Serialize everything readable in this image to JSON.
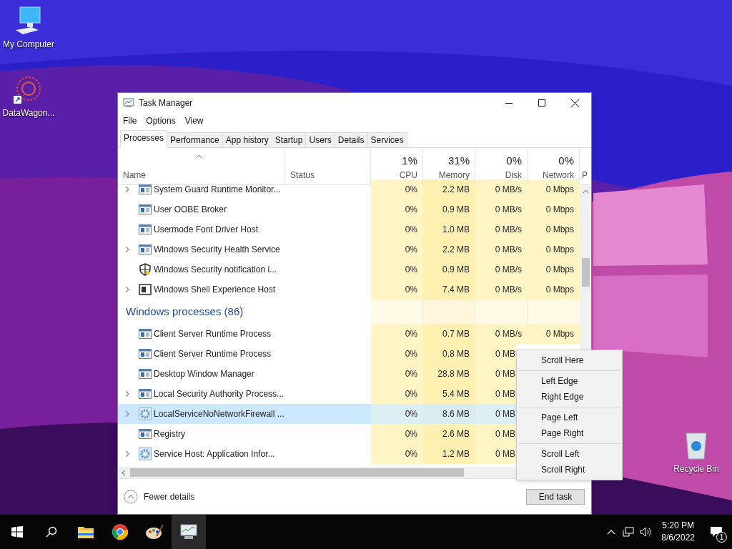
{
  "desktop_icons": [
    {
      "label": "My Computer",
      "kind": "computer"
    },
    {
      "label": "DataWagon...",
      "kind": "shortcut"
    },
    {
      "label": "Recycle Bin",
      "kind": "bin"
    }
  ],
  "window": {
    "title": "Task Manager"
  },
  "menu": [
    "File",
    "Options",
    "View"
  ],
  "tabs": [
    {
      "label": "Processes",
      "selected": true
    },
    {
      "label": "Performance",
      "selected": false
    },
    {
      "label": "App history",
      "selected": false
    },
    {
      "label": "Startup",
      "selected": false
    },
    {
      "label": "Users",
      "selected": false
    },
    {
      "label": "Details",
      "selected": false
    },
    {
      "label": "Services",
      "selected": false
    }
  ],
  "columns": [
    {
      "label": "Name"
    },
    {
      "label": "Status"
    },
    {
      "usage": "1%",
      "label": "CPU"
    },
    {
      "usage": "31%",
      "label": "Memory"
    },
    {
      "usage": "0%",
      "label": "Disk"
    },
    {
      "usage": "0%",
      "label": "Network"
    },
    {
      "label": "P"
    }
  ],
  "rows": [
    {
      "kind": "app",
      "expandable": true,
      "selected": false,
      "name": "System Guard Runtime Monitor...",
      "cpu": "0%",
      "memory": "2.2 MB",
      "disk": "0 MB/s",
      "network": "0 Mbps"
    },
    {
      "kind": "app",
      "expandable": false,
      "selected": false,
      "name": "User OOBE Broker",
      "cpu": "0%",
      "memory": "0.9 MB",
      "disk": "0 MB/s",
      "network": "0 Mbps"
    },
    {
      "kind": "app",
      "expandable": false,
      "selected": false,
      "name": "Usermode Font Driver Host",
      "cpu": "0%",
      "memory": "1.0 MB",
      "disk": "0 MB/s",
      "network": "0 Mbps"
    },
    {
      "kind": "app",
      "expandable": true,
      "selected": false,
      "name": "Windows Security Health Service",
      "cpu": "0%",
      "memory": "2.2 MB",
      "disk": "0 MB/s",
      "network": "0 Mbps"
    },
    {
      "kind": "shield",
      "expandable": false,
      "selected": false,
      "name": "Windows Security notification i...",
      "cpu": "0%",
      "memory": "0.9 MB",
      "disk": "0 MB/s",
      "network": "0 Mbps"
    },
    {
      "kind": "shell",
      "expandable": true,
      "selected": false,
      "name": "Windows Shell Experience Host",
      "cpu": "0%",
      "memory": "7.4 MB",
      "disk": "0 MB/s",
      "network": "0 Mbps"
    },
    {
      "kind": "group",
      "name": "Windows processes (86)"
    },
    {
      "kind": "app",
      "expandable": false,
      "selected": false,
      "name": "Client Server Runtime Process",
      "cpu": "0%",
      "memory": "0.7 MB",
      "disk": "0 MB/s",
      "network": "0 Mbps"
    },
    {
      "kind": "app",
      "expandable": false,
      "selected": false,
      "name": "Client Server Runtime Process",
      "cpu": "0%",
      "memory": "0.8 MB",
      "disk": "0 MB"
    },
    {
      "kind": "app",
      "expandable": false,
      "selected": false,
      "name": "Desktop Window Manager",
      "cpu": "0%",
      "memory": "28.8 MB",
      "disk": "0 MB"
    },
    {
      "kind": "app",
      "expandable": true,
      "selected": false,
      "name": "Local Security Authority Process...",
      "cpu": "0%",
      "memory": "5.4 MB",
      "disk": "0 MB"
    },
    {
      "kind": "service",
      "expandable": true,
      "selected": true,
      "name": "LocalServiceNoNetworkFirewall ...",
      "cpu": "0%",
      "memory": "8.6 MB",
      "disk": "0 MB"
    },
    {
      "kind": "app",
      "expandable": false,
      "selected": false,
      "name": "Registry",
      "cpu": "0%",
      "memory": "2.6 MB",
      "disk": "0 MB"
    },
    {
      "kind": "service",
      "expandable": true,
      "selected": false,
      "name": "Service Host: Application Infor...",
      "cpu": "0%",
      "memory": "1.2 MB",
      "disk": "0 MB"
    }
  ],
  "footer": {
    "fewer_details": "Fewer details",
    "end_task": "End task"
  },
  "context_menu": [
    [
      "Scroll Here"
    ],
    [
      "Left Edge",
      "Right Edge"
    ],
    [
      "Page Left",
      "Page Right"
    ],
    [
      "Scroll Left",
      "Scroll Right"
    ]
  ],
  "taskbar": {
    "apps": [
      {
        "kind": "folder",
        "active": false
      },
      {
        "kind": "browser",
        "active": false
      },
      {
        "kind": "paint",
        "active": false
      },
      {
        "kind": "taskmgr",
        "active": true
      }
    ],
    "time": "5:20 PM",
    "date": "8/6/2022",
    "notifications": "1"
  }
}
